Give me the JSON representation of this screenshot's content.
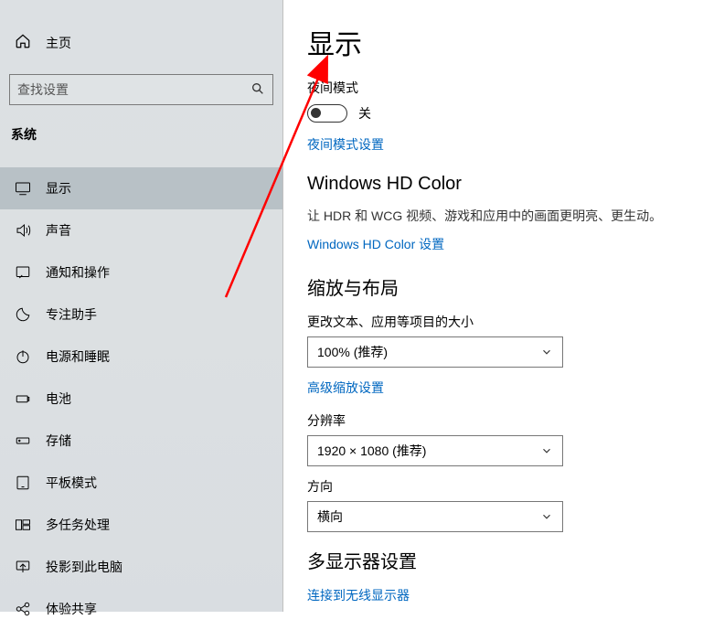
{
  "sidebar": {
    "home": "主页",
    "search_placeholder": "查找设置",
    "category": "系统",
    "items": [
      {
        "label": "显示",
        "icon": "display"
      },
      {
        "label": "声音",
        "icon": "sound"
      },
      {
        "label": "通知和操作",
        "icon": "notification"
      },
      {
        "label": "专注助手",
        "icon": "focus"
      },
      {
        "label": "电源和睡眠",
        "icon": "power"
      },
      {
        "label": "电池",
        "icon": "battery"
      },
      {
        "label": "存储",
        "icon": "storage"
      },
      {
        "label": "平板模式",
        "icon": "tablet"
      },
      {
        "label": "多任务处理",
        "icon": "multitask"
      },
      {
        "label": "投影到此电脑",
        "icon": "project"
      },
      {
        "label": "体验共享",
        "icon": "share"
      }
    ]
  },
  "content": {
    "title": "显示",
    "night_mode": {
      "label": "夜间模式",
      "state": "关",
      "link": "夜间模式设置"
    },
    "hd_color": {
      "title": "Windows HD Color",
      "desc": "让 HDR 和 WCG 视频、游戏和应用中的画面更明亮、更生动。",
      "link": "Windows HD Color 设置"
    },
    "scaling": {
      "title": "缩放与布局",
      "scale_label": "更改文本、应用等项目的大小",
      "scale_value": "100% (推荐)",
      "advanced_link": "高级缩放设置",
      "resolution_label": "分辨率",
      "resolution_value": "1920 × 1080 (推荐)",
      "orientation_label": "方向",
      "orientation_value": "横向"
    },
    "multi_display": {
      "title": "多显示器设置",
      "link": "连接到无线显示器"
    }
  }
}
